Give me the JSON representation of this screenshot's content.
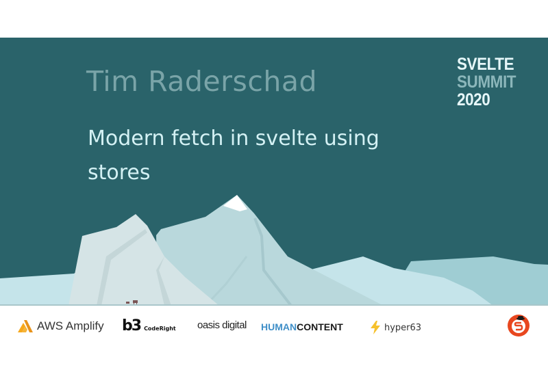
{
  "slide": {
    "speaker": "Tim Raderschad",
    "talk_title": "Modern fetch in svelte using stores",
    "brand": {
      "line1": "SVELTE",
      "line2": "SUMMIT",
      "line3": "2020"
    },
    "colors": {
      "background": "#2a636a",
      "speaker": "#7aa4a8",
      "title": "#d4f1f4"
    }
  },
  "sponsors": {
    "aws": {
      "icon": "aws-amplify-logo-icon",
      "label": "AWS Amplify"
    },
    "coderight": {
      "mark": "b3",
      "label": "CodeRight"
    },
    "oasis": {
      "label": "oasis digital"
    },
    "humancontent": {
      "part1": "HUMAN",
      "part2": "CONTENT"
    },
    "hyper63": {
      "icon": "lightning-bolt-icon",
      "label": "hyper63"
    },
    "svelte_society": {
      "icon": "svelte-society-badge-icon"
    }
  }
}
